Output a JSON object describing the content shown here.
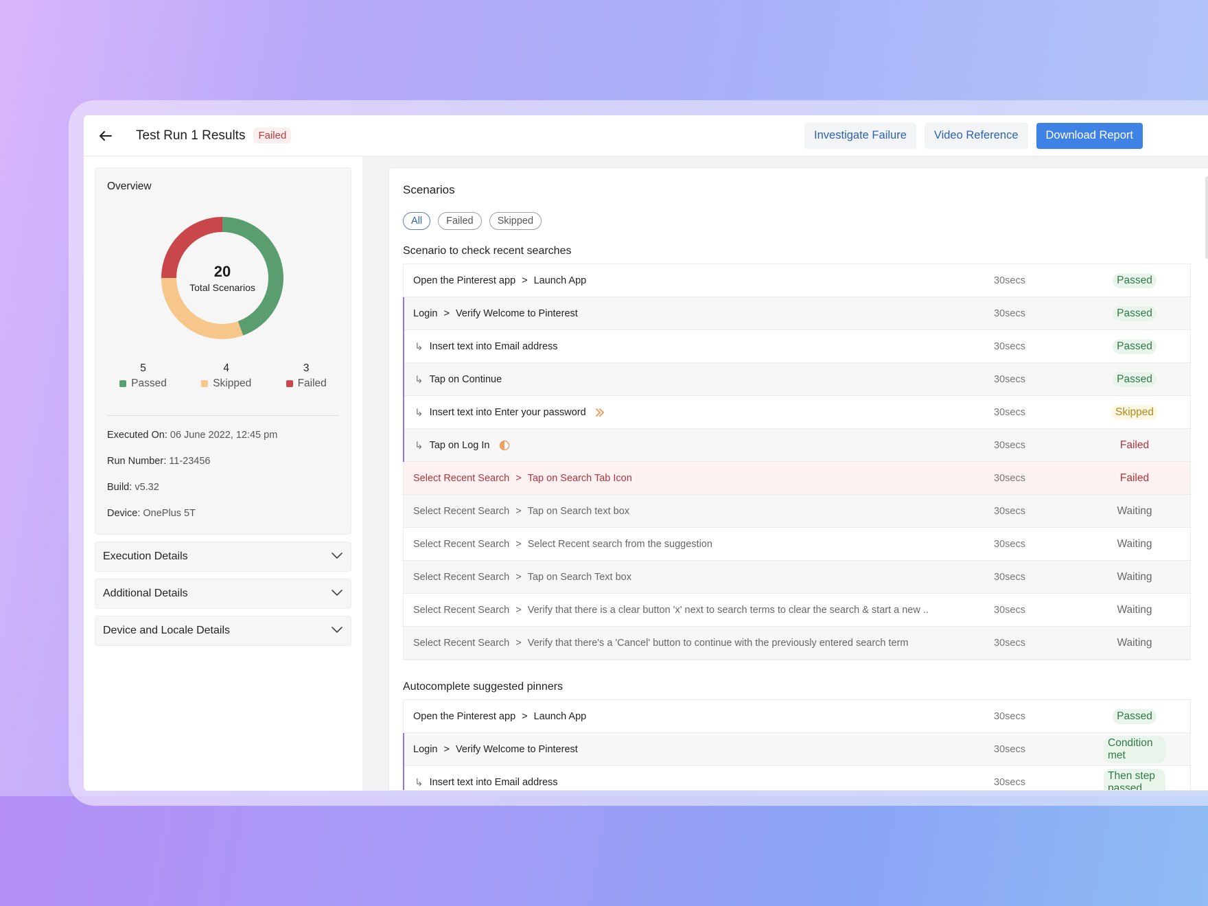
{
  "header": {
    "title": "Test Run 1 Results",
    "status": "Failed",
    "actions": {
      "investigate": "Investigate Failure",
      "video": "Video Reference",
      "download": "Download Report"
    }
  },
  "overview": {
    "title": "Overview",
    "total": "20",
    "total_caption": "Total Scenarios",
    "legend": [
      {
        "count": "5",
        "label": "Passed",
        "color": "#5a9e6f"
      },
      {
        "count": "4",
        "label": "Skipped",
        "color": "#f7c68a"
      },
      {
        "count": "3",
        "label": "Failed",
        "color": "#c9474b"
      }
    ],
    "donut_segments": [
      {
        "label": "Passed",
        "fraction": 0.445,
        "color": "#5a9e6f"
      },
      {
        "label": "Skipped",
        "fraction": 0.305,
        "color": "#f7c68a"
      },
      {
        "label": "Failed",
        "fraction": 0.25,
        "color": "#c9474b"
      }
    ],
    "meta": [
      {
        "key": "Executed On:",
        "value": "06 June 2022, 12:45 pm"
      },
      {
        "key": "Run Number:",
        "value": "11-23456"
      },
      {
        "key": "Build:",
        "value": "v5.32"
      },
      {
        "key": "Device:",
        "value": "OnePlus 5T"
      }
    ]
  },
  "accordions": [
    {
      "label": "Execution Details"
    },
    {
      "label": "Additional Details"
    },
    {
      "label": "Device and Locale Details"
    }
  ],
  "scenarios": {
    "title": "Scenarios",
    "filters": [
      {
        "label": "All",
        "active": true
      },
      {
        "label": "Failed",
        "active": false
      },
      {
        "label": "Skipped",
        "active": false
      }
    ],
    "groups": [
      {
        "title": "Scenario to check recent searches",
        "steps": [
          {
            "parent": "Open the Pinterest app",
            "sep": ">",
            "child": "Launch App",
            "duration": "30secs",
            "status": "Passed",
            "kind": "passed",
            "nested": false
          },
          {
            "parent": "Login",
            "sep": ">",
            "child": "Verify Welcome to Pinterest",
            "duration": "30secs",
            "status": "Passed",
            "kind": "passed",
            "nested": true
          },
          {
            "sub": "Insert text into Email address",
            "duration": "30secs",
            "status": "Passed",
            "kind": "passed",
            "nested": true
          },
          {
            "sub": "Tap on Continue",
            "duration": "30secs",
            "status": "Passed",
            "kind": "passed",
            "nested": true
          },
          {
            "sub": "Insert text into Enter your password",
            "icon": "skip-icon",
            "duration": "30secs",
            "status": "Skipped",
            "kind": "skipped",
            "nested": true
          },
          {
            "sub": "Tap on Log In",
            "icon": "half-circle-icon",
            "duration": "30secs",
            "status": "Failed",
            "kind": "failed-text",
            "nested": true
          },
          {
            "parent": "Select Recent Search",
            "sep": ">",
            "child": "Tap on Search Tab Icon",
            "duration": "30secs",
            "status": "Failed",
            "kind": "failed",
            "nested": false
          },
          {
            "parent": "Select Recent Search",
            "sep": ">",
            "child": "Tap on Search text box",
            "duration": "30secs",
            "status": "Waiting",
            "kind": "waiting",
            "nested": false
          },
          {
            "parent": "Select Recent Search",
            "sep": ">",
            "child": "Select Recent search from the suggestion",
            "duration": "30secs",
            "status": "Waiting",
            "kind": "waiting",
            "nested": false
          },
          {
            "parent": "Select Recent Search",
            "sep": ">",
            "child": "Tap on Search Text box",
            "duration": "30secs",
            "status": "Waiting",
            "kind": "waiting",
            "nested": false
          },
          {
            "parent": "Select Recent Search",
            "sep": ">",
            "child": "Verify that there is a clear button 'x' next to search terms to clear the search & start a new ..",
            "duration": "30secs",
            "status": "Waiting",
            "kind": "waiting",
            "nested": false
          },
          {
            "parent": "Select Recent Search",
            "sep": ">",
            "child": "Verify that there's a 'Cancel' button to continue with the previously entered search term",
            "duration": "30secs",
            "status": "Waiting",
            "kind": "waiting",
            "nested": false
          }
        ]
      },
      {
        "title": "Autocomplete suggested pinners",
        "steps": [
          {
            "parent": "Open the Pinterest app",
            "sep": ">",
            "child": "Launch App",
            "duration": "30secs",
            "status": "Passed",
            "kind": "passed",
            "nested": false
          },
          {
            "parent": "Login",
            "sep": ">",
            "child": "Verify Welcome to Pinterest",
            "duration": "30secs",
            "status": "Condition met",
            "kind": "passed",
            "nested": true
          },
          {
            "sub": "Insert text into Email address",
            "duration": "30secs",
            "status": "Then step passed",
            "kind": "passed",
            "nested": true
          }
        ]
      }
    ]
  }
}
